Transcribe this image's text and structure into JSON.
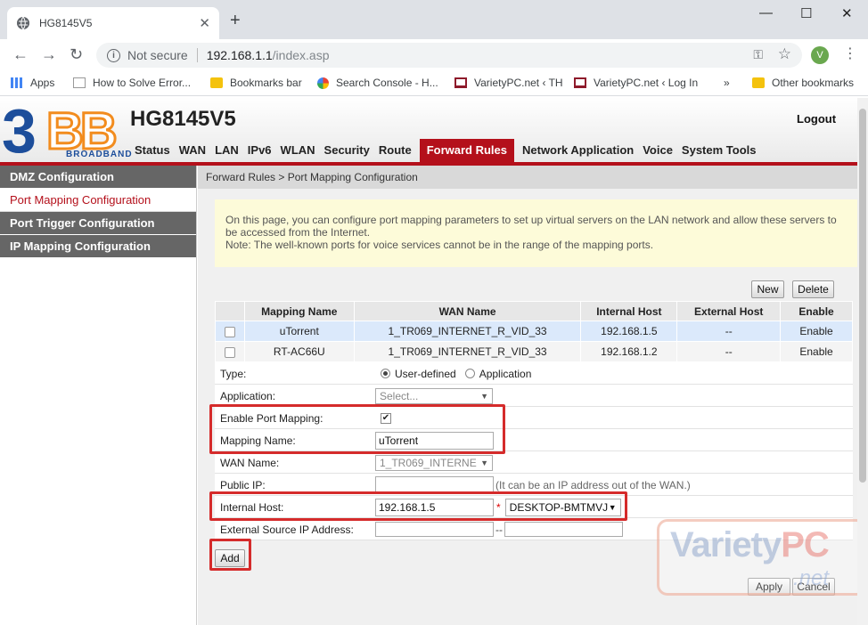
{
  "browser": {
    "tab_title": "HG8145V5",
    "tab_close": "✕",
    "new_tab": "+",
    "window_controls": [
      "—",
      "☐",
      "✕"
    ],
    "security_label": "Not secure",
    "url_host": "192.168.1.1",
    "url_path": "/index.asp",
    "profile_initial": "V",
    "bookmarks": [
      {
        "label": "Apps",
        "icon": "apps-grid-icon"
      },
      {
        "label": "How to Solve Error...",
        "icon": "page-icon"
      },
      {
        "label": "Bookmarks bar",
        "icon": "folder-icon"
      },
      {
        "label": "Search Console - H...",
        "icon": "google-icon"
      },
      {
        "label": "VarietyPC.net ‹ TH",
        "icon": "laptop-icon"
      },
      {
        "label": "VarietyPC.net ‹ Log In",
        "icon": "laptop-icon"
      },
      {
        "label": "»",
        "icon": "more-icon"
      },
      {
        "label": "Other bookmarks",
        "icon": "folder-icon"
      }
    ]
  },
  "router": {
    "logo_number": "3",
    "logo_letters": "BB",
    "logo_tagline": "BROADBAND",
    "model": "HG8145V5",
    "logout": "Logout",
    "nav": [
      "Status",
      "WAN",
      "LAN",
      "IPv6",
      "WLAN",
      "Security",
      "Route",
      "Forward Rules",
      "Network Application",
      "Voice",
      "System Tools"
    ],
    "nav_active": "Forward Rules",
    "sidebar": [
      {
        "label": "DMZ Configuration",
        "active": false
      },
      {
        "label": "Port Mapping Configuration",
        "active": true
      },
      {
        "label": "Port Trigger Configuration",
        "active": false
      },
      {
        "label": "IP Mapping Configuration",
        "active": false
      }
    ],
    "breadcrumb": "Forward Rules > Port Mapping Configuration",
    "notice_line1": "On this page, you can configure port mapping parameters to set up virtual servers on the LAN network and allow these servers to be accessed from the Internet.",
    "notice_line2": "Note: The well-known ports for voice services cannot be in the range of the mapping ports.",
    "buttons": {
      "new": "New",
      "delete": "Delete",
      "add": "Add",
      "apply": "Apply",
      "cancel": "Cancel"
    },
    "table": {
      "headers": [
        "",
        "Mapping Name",
        "WAN Name",
        "Internal Host",
        "External Host",
        "Enable"
      ],
      "rows": [
        [
          "",
          "uTorrent",
          "1_TR069_INTERNET_R_VID_33",
          "192.168.1.5",
          "--",
          "Enable"
        ],
        [
          "",
          "RT-AC66U",
          "1_TR069_INTERNET_R_VID_33",
          "192.168.1.2",
          "--",
          "Enable"
        ]
      ]
    },
    "form": {
      "type_label": "Type:",
      "type_opt1": "User-defined",
      "type_opt2": "Application",
      "application_label": "Application:",
      "application_placeholder": "Select...",
      "enable_label": "Enable Port Mapping:",
      "enable_check": "✔",
      "mapping_name_label": "Mapping Name:",
      "mapping_name_value": "uTorrent",
      "wan_name_label": "WAN Name:",
      "wan_name_value": "1_TR069_INTERNE",
      "public_ip_label": "Public IP:",
      "public_ip_hint": "(It can be an IP address out of the WAN.)",
      "internal_host_label": "Internal Host:",
      "internal_host_value": "192.168.1.5",
      "required_mark": "*",
      "internal_host_device": "DESKTOP-BMTMVJ",
      "ext_source_label": "External Source IP Address:",
      "range_sep": "--"
    }
  },
  "watermark": {
    "text1": "Variety",
    "text2": "PC",
    "text3": ".net"
  },
  "colors": {
    "accent_red": "#b4101b",
    "highlight_box": "#d52b2b",
    "notice_bg": "#fdfbd9",
    "logo_blue": "#1d4e9b",
    "logo_orange": "#f28c1e"
  }
}
